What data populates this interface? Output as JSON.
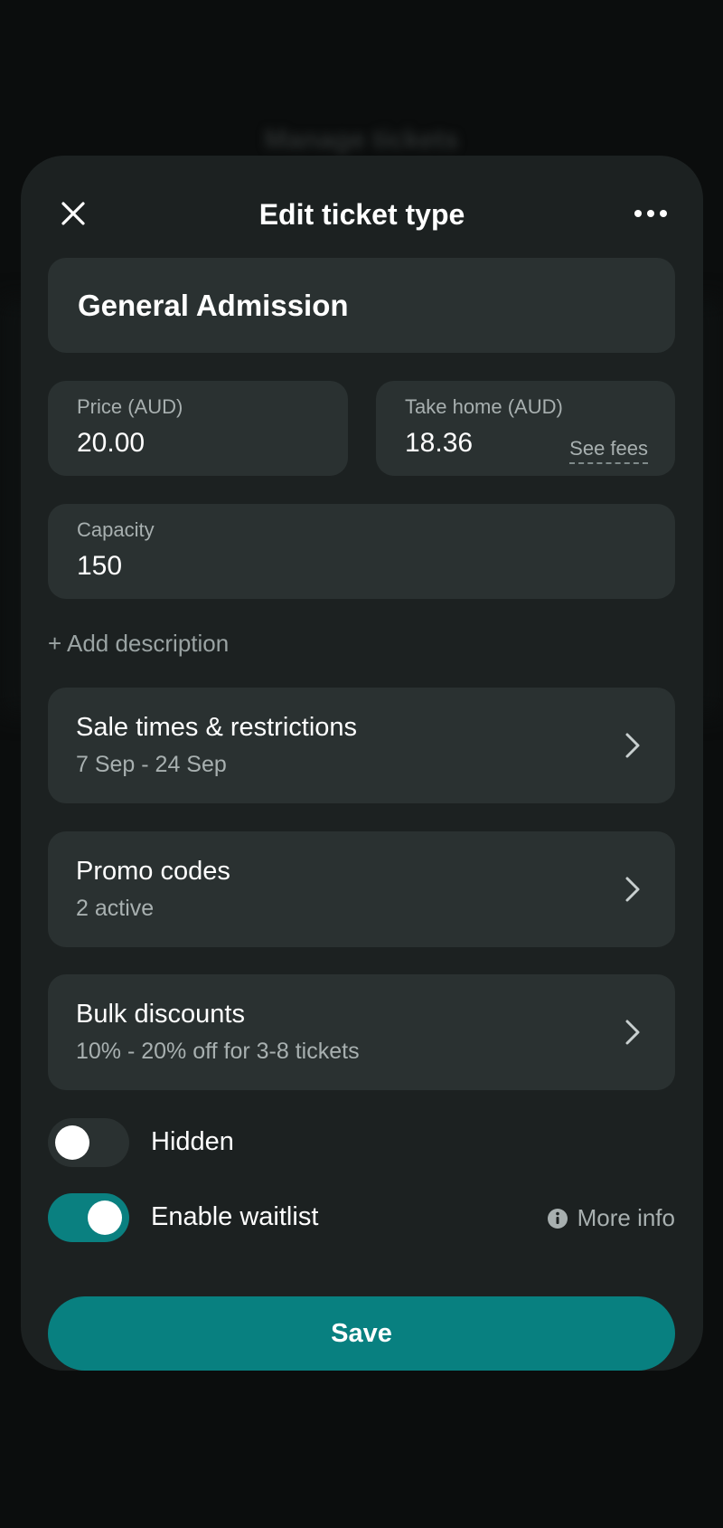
{
  "background": {
    "title": "Manage tickets"
  },
  "header": {
    "title": "Edit ticket type"
  },
  "ticket": {
    "name": "General Admission"
  },
  "price": {
    "label": "Price (AUD)",
    "value": "20.00"
  },
  "take_home": {
    "label": "Take home (AUD)",
    "value": "18.36",
    "see_fees": "See fees"
  },
  "capacity": {
    "label": "Capacity",
    "value": "150"
  },
  "add_description": "+ Add description",
  "nav_cards": [
    {
      "title": "Sale times & restrictions",
      "subtitle": "7 Sep - 24 Sep"
    },
    {
      "title": "Promo codes",
      "subtitle": "2 active"
    },
    {
      "title": "Bulk discounts",
      "subtitle": "10% - 20% off for 3-8 tickets"
    }
  ],
  "toggles": {
    "hidden": {
      "label": "Hidden",
      "on": false
    },
    "waitlist": {
      "label": "Enable waitlist",
      "on": true,
      "more_info": "More info"
    }
  },
  "save_label": "Save",
  "colors": {
    "accent": "#088080",
    "card": "#2a3131",
    "sheet": "#1c2121",
    "background": "#0b0d0d"
  },
  "icons": [
    "close-icon",
    "more-horizontal-icon",
    "chevron-right-icon",
    "info-icon"
  ]
}
